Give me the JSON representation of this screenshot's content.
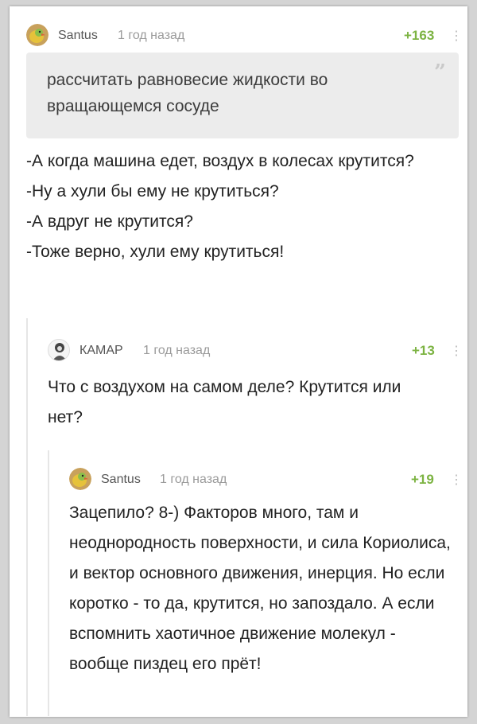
{
  "comments": [
    {
      "author": "Santus",
      "time": "1 год назад",
      "rating": "+163",
      "more": "⋮",
      "quote": "рассчитать равновесие жидкости во вращающемся сосуде",
      "quote_mark": "”",
      "lines": [
        "-А когда машина едет, воздух в колесах крутится?",
        "-Ну а хули бы ему не крутиться?",
        "-А вдруг не крутится?",
        "-Тоже верно, хули ему крутиться!"
      ]
    },
    {
      "author": "КАМАР",
      "time": "1 год назад",
      "rating": "+13",
      "more": "⋮",
      "text": "Что с воздухом на самом деле? Крутится или нет?"
    },
    {
      "author": "Santus",
      "time": "1 год назад",
      "rating": "+19",
      "more": "⋮",
      "text": "Зацепило? 8-) Факторов много, там и неоднородность поверхности, и сила Кориолиса, и вектор основного движения, инерция. Но если коротко - то да, крутится, но запоздало. А если вспомнить хаотичное движение молекул - вообще пиздец его прёт!"
    }
  ],
  "colors": {
    "rating": "#7cb342",
    "quote_bg": "#ececec",
    "author": "#555555",
    "time": "#9a9a9a"
  },
  "icons": [
    "parrot-avatar-icon",
    "person-avatar-icon",
    "more-vertical-icon"
  ]
}
